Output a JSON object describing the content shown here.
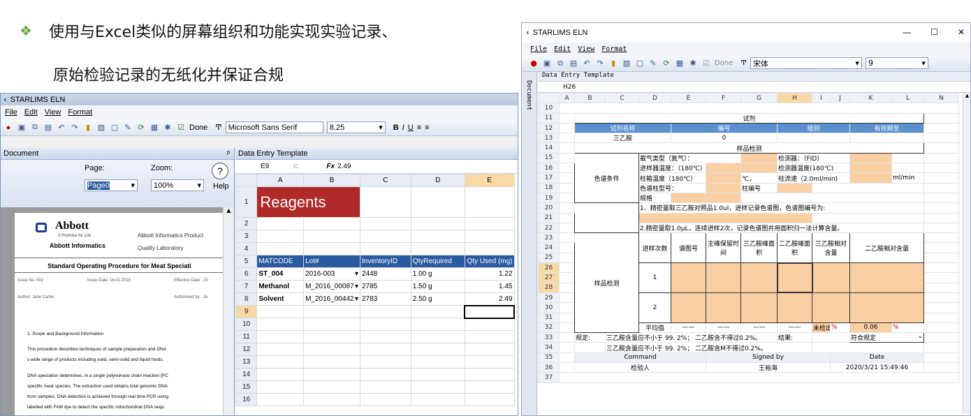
{
  "slide": {
    "bullet": "❖",
    "line1": "使用与Excel类似的屏幕组织和功能实现实验记录、",
    "line2": "原始检验记录的无纸化并保证合规"
  },
  "left_window": {
    "title": "STARLIMS ELN",
    "menu": [
      "File",
      "Edit",
      "View",
      "Format"
    ],
    "toolbar": {
      "done": "Done",
      "font": "Microsoft Sans Serif",
      "size": "8.25"
    },
    "document_panel": {
      "title": "Document",
      "page_label": "Page:",
      "page_value": "Page0",
      "zoom_label": "Zoom:",
      "zoom_value": "100%",
      "help": "Help"
    },
    "doc": {
      "company": "Abbott",
      "tagline": "A Promise for Life",
      "division": "Abbott Informatics",
      "header_right": "Abbott Informatics Product Quality Laboratory",
      "sop_title": "Standard Operating Procedure for Meat Speciati",
      "issue_no": "Issue No: 002",
      "issue_date": "Issue Date: 16.02.2015",
      "effective": "Effective Date : 20",
      "author": "Author: Jane Carter",
      "authorised": "Authorised by : Ja",
      "section": "1.      Scope and Background Information",
      "p1": "This procedure describes techniques of sample preparation and DNA",
      "p2": "s wide range of products including solid, semi-solid and liquid foods.",
      "p3": "DNA speciation determines, in a single polymerase chain reaction (PC",
      "p4": "specific meat species. The extraction used obtains total genomic DNA",
      "p5": "from samples. DNA detection is achieved through real time PCR using",
      "p6": "labelled with FAM dye to detect the specific mitochondrial DNA sequ"
    },
    "grid": {
      "panel_title": "Data Entry Template",
      "cell_ref": "E9",
      "fx": "Fx",
      "formula": "2.49",
      "columns": [
        "A",
        "B",
        "C",
        "D",
        "E"
      ],
      "banner": "Reagents",
      "headers": [
        "MATCODE",
        "Lot#",
        "InventoryID",
        "QtyRequired",
        "Qty Used (mg)"
      ],
      "rows": [
        [
          "ST_004",
          "2016-003",
          "2448",
          "1.00 g",
          "1.22"
        ],
        [
          "Methanol",
          "M_2016_00087",
          "2785",
          "1.50 g",
          "1.45"
        ],
        [
          "Solvent",
          "M_2016_00442",
          "2783",
          "2.50 g",
          "2.49"
        ]
      ],
      "row_numbers": [
        "1",
        "2",
        "3",
        "4",
        "5",
        "6",
        "7",
        "8",
        "9",
        "10",
        "11",
        "12",
        "13",
        "14",
        "15",
        "16"
      ]
    }
  },
  "right_window": {
    "title": "STARLIMS ELN",
    "menu": [
      "File",
      "Edit",
      "View",
      "Format"
    ],
    "toolbar": {
      "done": "Done",
      "font": "宋体",
      "size": "9"
    },
    "sidebar": "Document",
    "panel_title": "Data Entry Template",
    "cell_ref": "H26",
    "columns": [
      "A",
      "B",
      "C",
      "D",
      "E",
      "F",
      "G",
      "H",
      "I",
      "J",
      "K",
      "L",
      "N"
    ],
    "row_numbers": [
      "10",
      "11",
      "12",
      "13",
      "14",
      "15",
      "16",
      "17",
      "18",
      "19",
      "20",
      "21",
      "22",
      "23",
      "24",
      "25",
      "26",
      "27",
      "28",
      "29",
      "30",
      "31",
      "32",
      "33",
      "34",
      "35",
      "36",
      "37"
    ],
    "form": {
      "reagent_title": "试剂",
      "h_name": "试剂名称",
      "h_no": "编号",
      "h_grade": "级别",
      "h_expiry": "有效期至",
      "reagent": "三乙胺",
      "reagent_no": "0",
      "sample_check": "样品检测",
      "gc_label": "色谱条件",
      "carrier": "载气类型（氮气）：",
      "detector": "检测器：（FID）",
      "inlet": "进样器温度：（180℃）",
      "det_temp": "检测器温度(180℃)",
      "column_temp": "柱箱温度（180℃）",
      "deg": "℃，",
      "flow": "柱流速（2.0ml/min)",
      "flow_unit": "ml/min",
      "column_model": "色谱柱型号：",
      "column_no": "柱编号",
      "spec": "规格",
      "step1": "1、精密量取三乙胺对照品1.0ul，进样记录色谱图，色谱图编号为:",
      "step2": "2.精密量取1.0μL，连续进样2次，记录色谱图并用面积归一法计算含量。",
      "sample_label": "样品检测",
      "th": [
        "进样次数",
        "谱图号",
        "主峰保留时间",
        "三乙胺峰面积",
        "二乙胺峰面积",
        "三乙胺相对含量",
        "二乙胺相对含量"
      ],
      "inj1": "1",
      "inj2": "2",
      "avg": "平均值",
      "dash": "——",
      "not_detected": "未检出",
      "pct": "%",
      "avg_val": "0.06",
      "spec_label": "规定:",
      "spec_text": "三乙胺含量应不小于 99. 2%； 二乙胺含不得过0.2%。",
      "result_label": "结果:",
      "result_value": "符合规定",
      "spec_text2": "三乙胺含量应不小于 99. 2%； 二乙胺含M不得过0.2%。",
      "cmd": "Command",
      "signed": "Signed by",
      "date": "Date",
      "role": "检验人",
      "signer": "王裕海",
      "datetime": "2020/3/21 15:49:46"
    }
  }
}
